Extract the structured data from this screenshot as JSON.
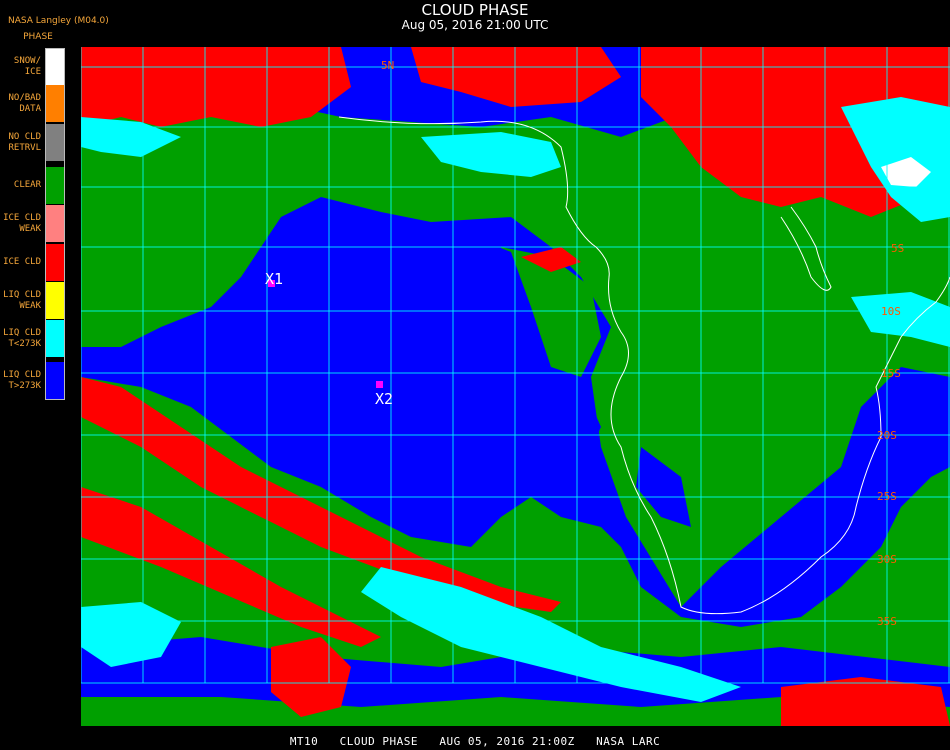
{
  "header": {
    "title": "CLOUD PHASE",
    "subtitle": "Aug 05, 2016 21:00 UTC",
    "org": "NASA Langley (M04.0)",
    "product": "PHASE"
  },
  "legend": {
    "items": [
      {
        "line1": "SNOW/",
        "line2": "ICE",
        "color": "#ffffff"
      },
      {
        "line1": "NO/BAD",
        "line2": "DATA",
        "color": "#ff7f00"
      },
      {
        "line1": "NO CLD",
        "line2": "RETRVL",
        "color": "#808080"
      },
      {
        "line1": "CLEAR",
        "line2": "",
        "color": "#00a000"
      },
      {
        "line1": "ICE CLD",
        "line2": "WEAK",
        "color": "#ff8080"
      },
      {
        "line1": "ICE CLD",
        "line2": "",
        "color": "#ff0000"
      },
      {
        "line1": "LIQ CLD",
        "line2": "WEAK",
        "color": "#ffff00"
      },
      {
        "line1": "LIQ CLD",
        "line2": "T<273K",
        "color": "#00ffff"
      },
      {
        "line1": "LIQ CLD",
        "line2": "T>273K",
        "color": "#0000ff"
      }
    ]
  },
  "map": {
    "markers": [
      {
        "label": "X1",
        "color": "#ff00ff"
      },
      {
        "label": "X2",
        "color": "#ff00ff"
      }
    ],
    "lat_labels": [
      "5N",
      "5S",
      "10S",
      "15S",
      "20S",
      "25S",
      "30S",
      "35S"
    ],
    "grid_color": "#00ffff",
    "coast_color": "#ffffff",
    "lat_label_color": "#ff5a00"
  },
  "footer": {
    "text": "MT10   CLOUD PHASE   AUG 05, 2016 21:00Z   NASA LARC"
  }
}
